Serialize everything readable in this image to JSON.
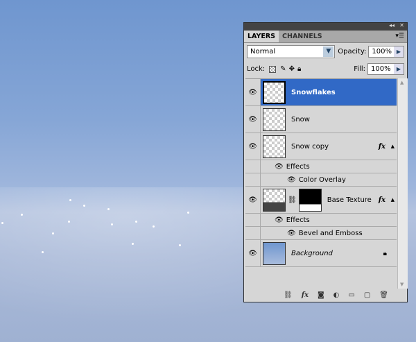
{
  "panel": {
    "tabs": [
      "LAYERS",
      "CHANNELS"
    ],
    "blend_mode": "Normal",
    "opacity_label": "Opacity:",
    "opacity": "100%",
    "lock_label": "Lock:",
    "fill_label": "Fill:",
    "fill": "100%"
  },
  "layers": [
    {
      "name": "Snowflakes",
      "selected": true
    },
    {
      "name": "Snow"
    },
    {
      "name": "Snow copy",
      "fx": "fx"
    },
    {
      "effects": "Effects",
      "effect": "Color Overlay"
    },
    {
      "name": "Base Texture",
      "fx": "fx"
    },
    {
      "effects": "Effects",
      "effect": "Bevel and Emboss"
    },
    {
      "name": "Background"
    }
  ],
  "colors": {
    "selection": "#3169c6",
    "panel": "#d6d6d6"
  }
}
